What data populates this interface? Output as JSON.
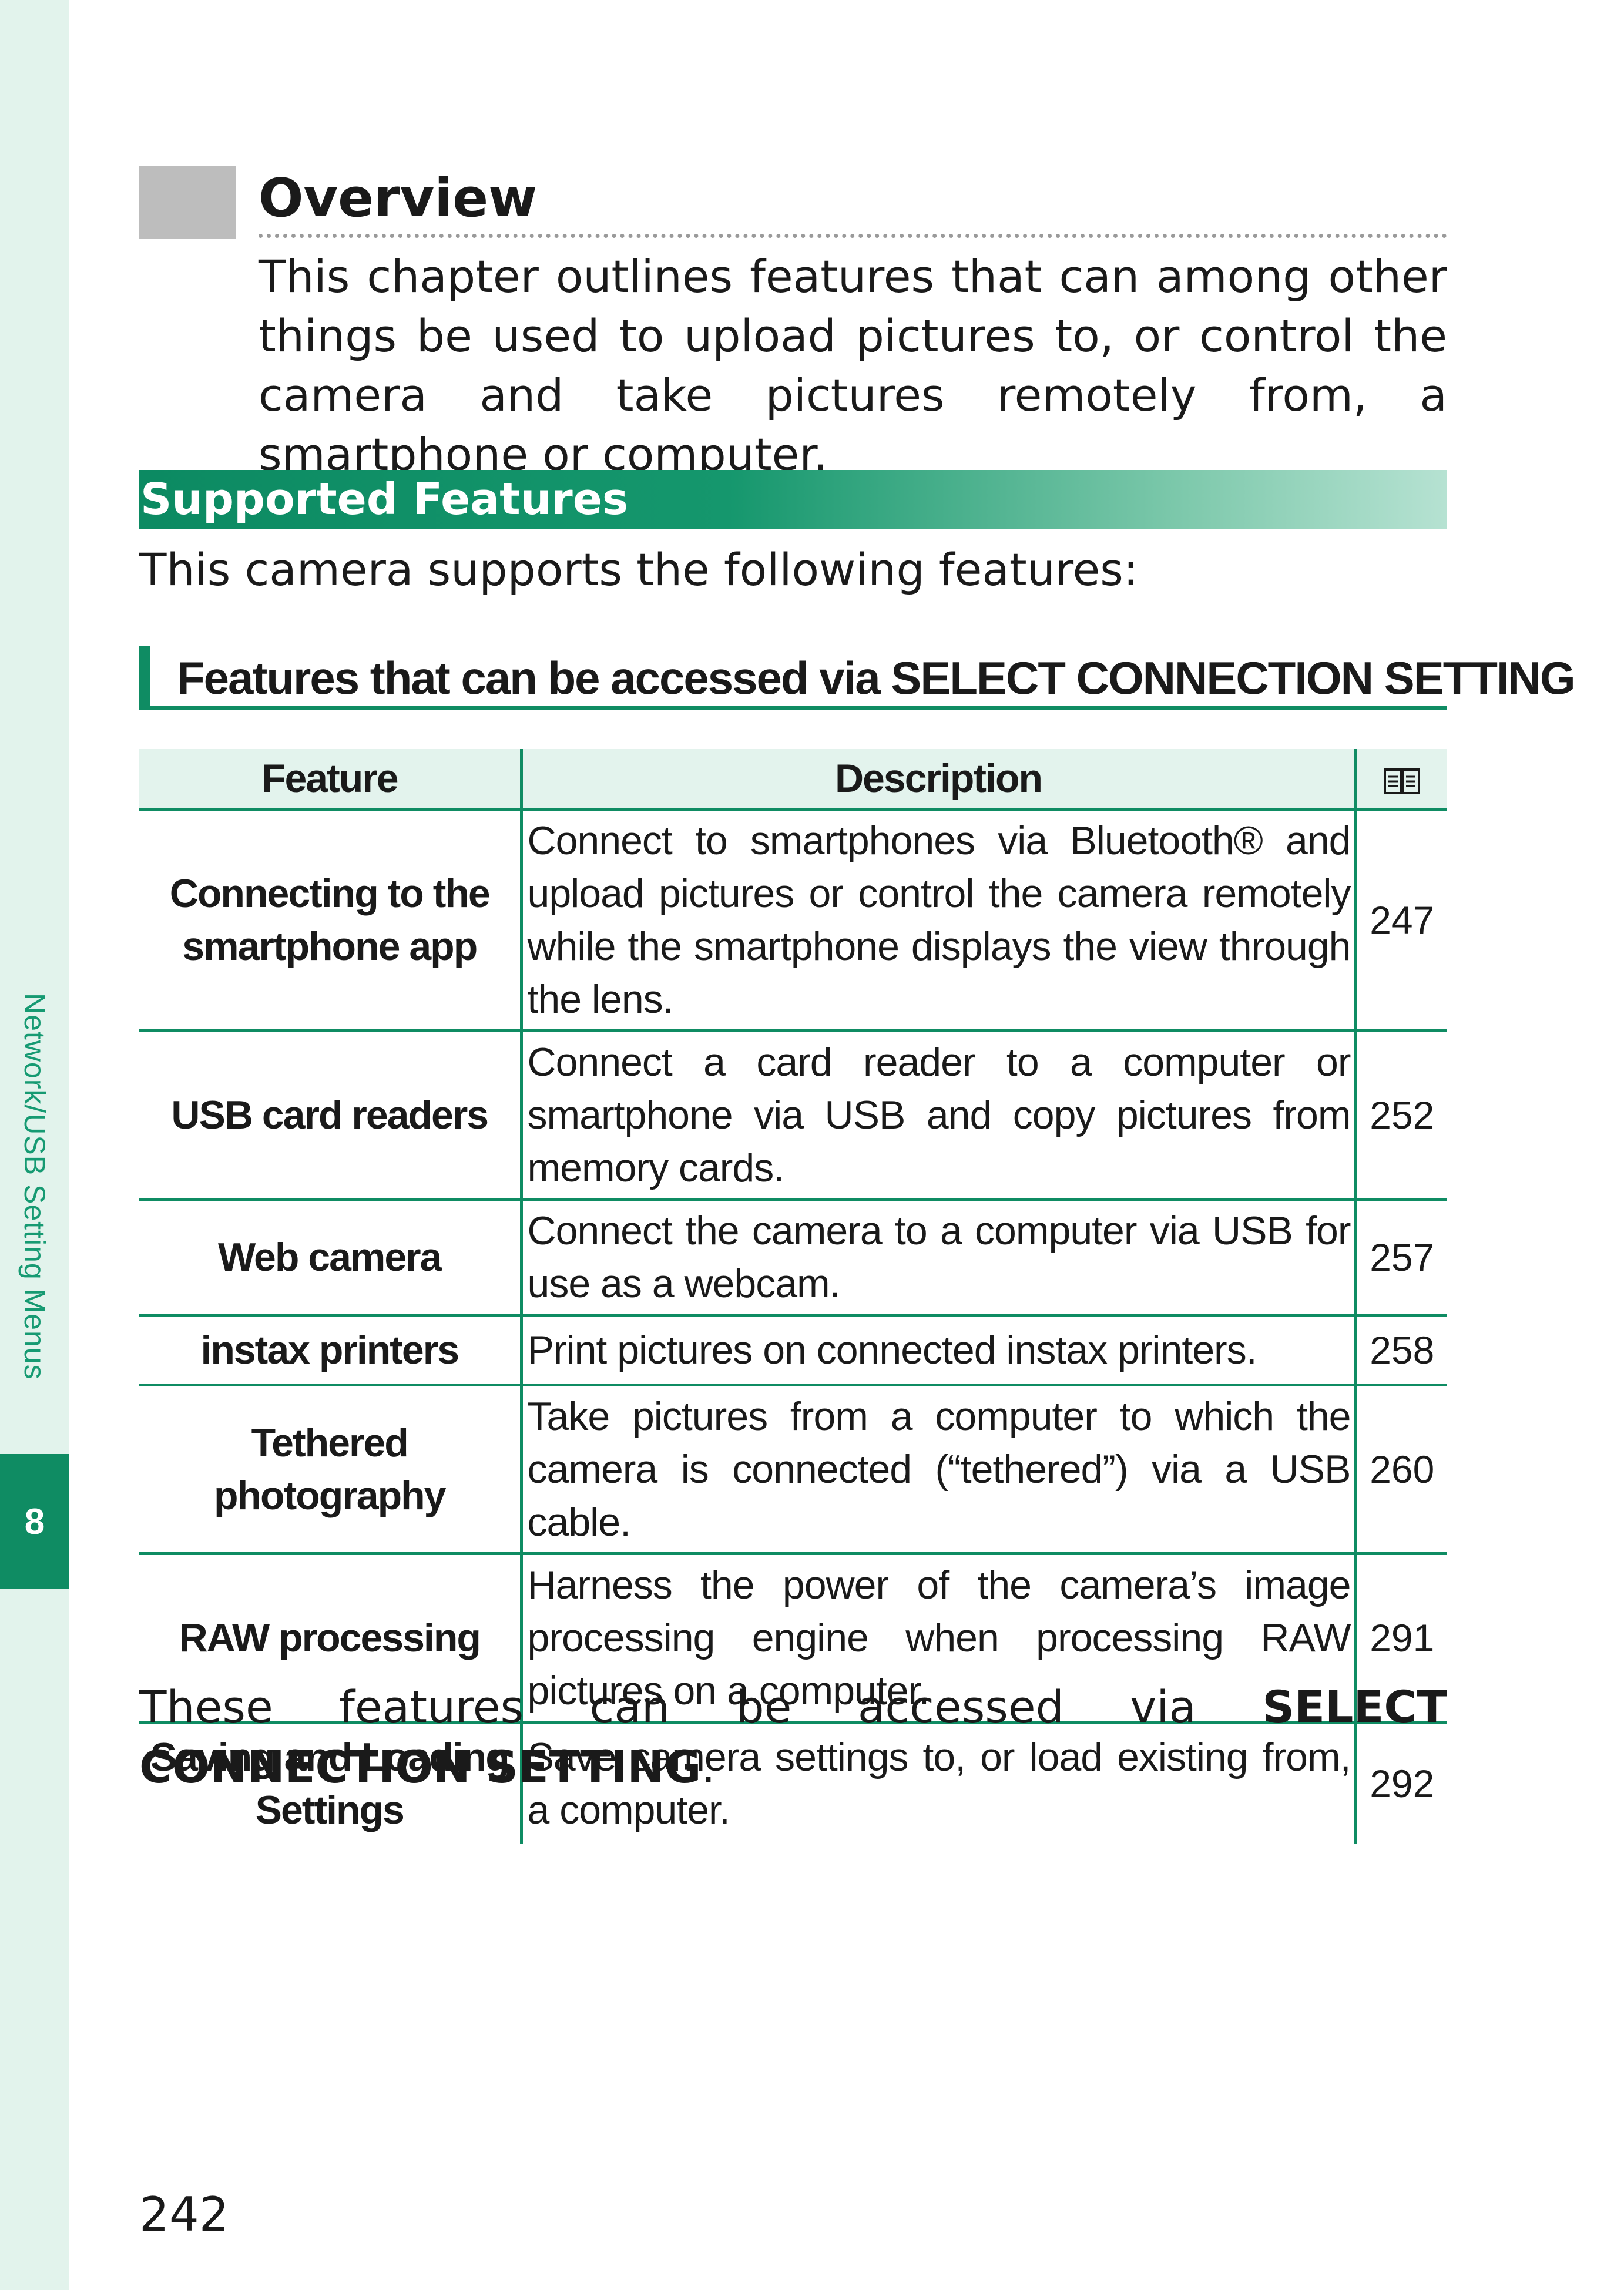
{
  "sidebar": {
    "section_label": "Network/USB Setting Menus",
    "chapter_number": "8"
  },
  "overview": {
    "title": "Overview",
    "body": "This chapter outlines features that can among other things be used to upload pictures to, or control the camera and take pictures remotely from, a smartphone or computer."
  },
  "supported": {
    "title": "Supported Features",
    "intro": "This camera supports the following features:"
  },
  "subsection": {
    "title": "Features that can be accessed via SELECT CONNECTION SETTING"
  },
  "table": {
    "headers": {
      "feature": "Feature",
      "description": "Description",
      "page_icon": "book-icon"
    },
    "rows": [
      {
        "feature": "Connecting to the smartphone app",
        "description": "Connect to smartphones via Bluetooth® and upload pictures or control the camera remotely while the smartphone displays the view through the lens.",
        "page": "247"
      },
      {
        "feature": "USB card readers",
        "description": "Connect a card reader to a computer or smartphone via USB and copy pictures from memory cards.",
        "page": "252"
      },
      {
        "feature": "Web camera",
        "description": "Connect the camera to a computer via USB for use as a webcam.",
        "page": "257"
      },
      {
        "feature": "instax printers",
        "description": "Print pictures on connected instax printers.",
        "page": "258"
      },
      {
        "feature": "Tethered photography",
        "description": "Take pictures from a computer to which the camera is connected (“tethered”) via a USB cable.",
        "page": "260"
      },
      {
        "feature": "RAW processing",
        "description": "Harness the power of the camera’s image processing engine when processing RAW pictures on a computer.",
        "page": "291"
      },
      {
        "feature": "Saving and Loading Settings",
        "description": "Save camera settings to, or load existing from, a computer.",
        "page": "292"
      }
    ]
  },
  "outro": {
    "prefix": "These features can be accessed via ",
    "emphasis": "SELECT CONNECTION SETTING",
    "suffix": "."
  },
  "page_number": "242",
  "colors": {
    "accent": "#0f8c63",
    "strip": "#e2f3ec",
    "header_fill": "#e3f3ed"
  }
}
